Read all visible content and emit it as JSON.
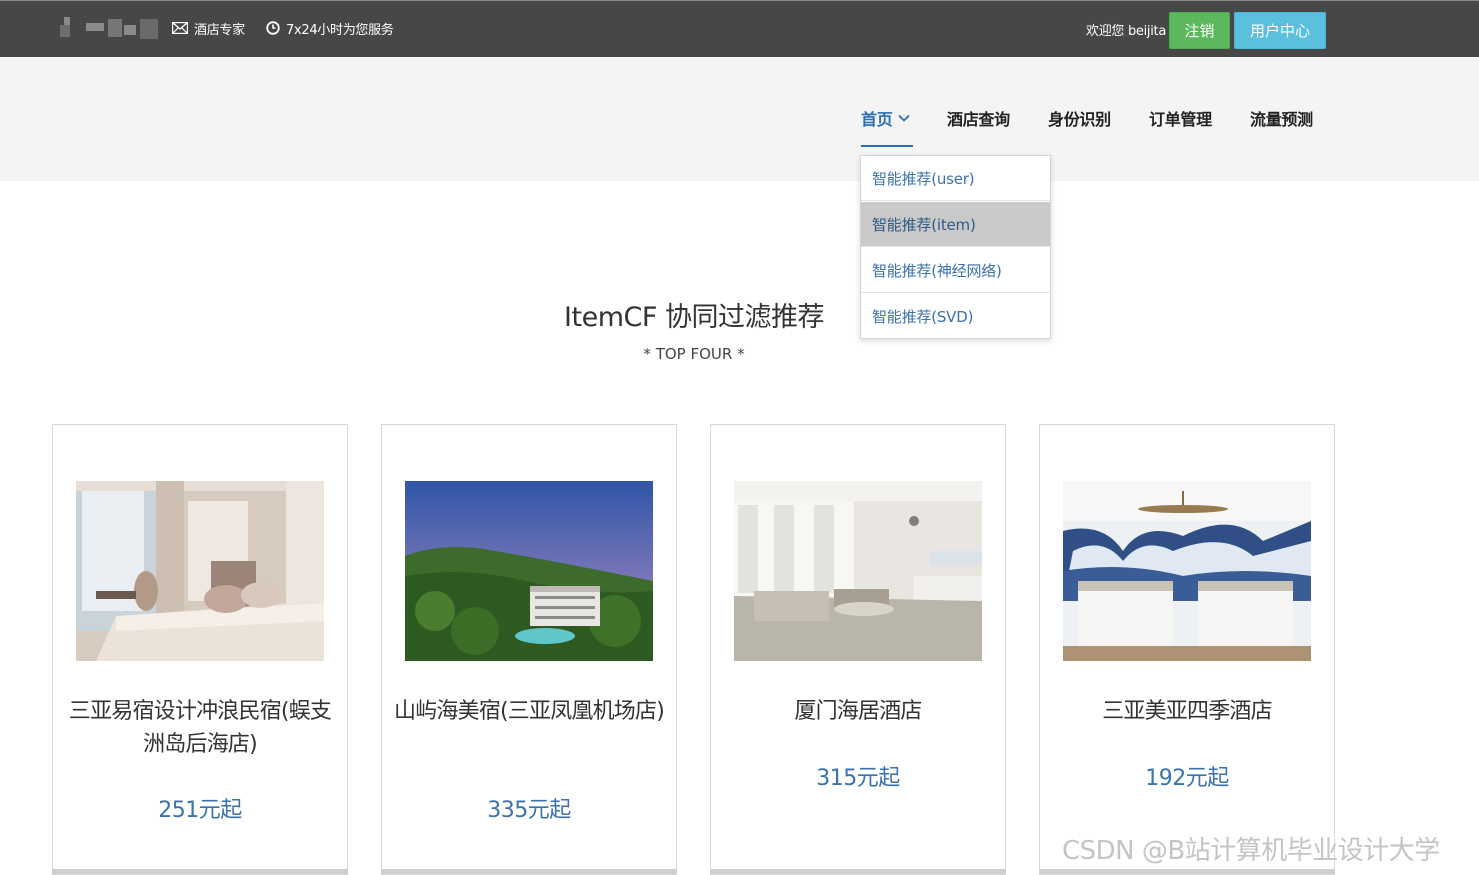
{
  "topbar": {
    "site_name": "酒店专家",
    "service_hours": "7x24小时为您服务",
    "welcome": "欢迎您 beijita",
    "logout_label": "注销",
    "user_center_label": "用户中心",
    "colors": {
      "bg": "#474747",
      "logout": "#5cb85c",
      "user_center": "#5bc0de"
    }
  },
  "nav": {
    "items": [
      {
        "label": "首页",
        "active": true
      },
      {
        "label": "酒店查询"
      },
      {
        "label": "身份识别"
      },
      {
        "label": "订单管理"
      },
      {
        "label": "流量预测"
      }
    ],
    "dropdown": [
      {
        "label": "智能推荐(user)"
      },
      {
        "label": "智能推荐(item)",
        "highlighted": true
      },
      {
        "label": "智能推荐(神经网络)"
      },
      {
        "label": "智能推荐(SVD)"
      }
    ]
  },
  "section": {
    "title": "ItemCF 协同过滤推荐",
    "subtitle": "* TOP FOUR *"
  },
  "hotels": [
    {
      "name": "三亚易宿设计冲浪民宿(蜈支洲岛后海店)",
      "price": "251元起"
    },
    {
      "name": "山屿海美宿(三亚凤凰机场店)",
      "price": "335元起"
    },
    {
      "name": "厦门海居酒店",
      "price": "315元起"
    },
    {
      "name": "三亚美亚四季酒店",
      "price": "192元起"
    }
  ],
  "watermark": "CSDN @B站计算机毕业设计大学"
}
